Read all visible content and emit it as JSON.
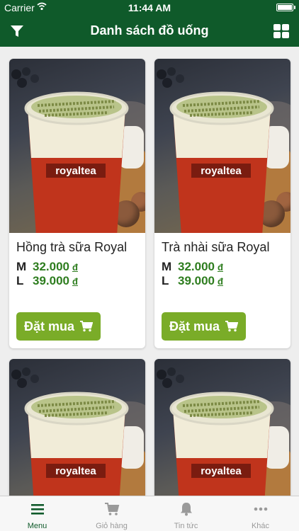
{
  "status": {
    "carrier": "Carrier",
    "time": "11:44 AM"
  },
  "nav": {
    "title": "Danh sách đồ uống",
    "filter_icon": "filter-icon",
    "grid_icon": "grid-view-icon"
  },
  "products": [
    {
      "name": "Hồng trà sữa Royal",
      "prices": [
        {
          "size": "M",
          "amount": "32.000",
          "currency": "đ"
        },
        {
          "size": "L",
          "amount": "39.000",
          "currency": "đ"
        }
      ],
      "button": "Đặt mua",
      "cup_brand": "royaltea"
    },
    {
      "name": "Trà nhài sữa Royal",
      "prices": [
        {
          "size": "M",
          "amount": "32.000",
          "currency": "đ"
        },
        {
          "size": "L",
          "amount": "39.000",
          "currency": "đ"
        }
      ],
      "button": "Đặt mua",
      "cup_brand": "royaltea"
    },
    {
      "cup_brand": "royaltea"
    },
    {
      "cup_brand": "royaltea"
    }
  ],
  "tabs": [
    {
      "label": "Menu",
      "icon": "menu-icon",
      "active": true
    },
    {
      "label": "Giỏ hàng",
      "icon": "cart-icon",
      "active": false
    },
    {
      "label": "Tin tức",
      "icon": "bell-icon",
      "active": false
    },
    {
      "label": "Khác",
      "icon": "more-icon",
      "active": false
    }
  ],
  "colors": {
    "primary": "#0f5a2a",
    "button": "#7aac28",
    "price": "#2e7d1f"
  }
}
